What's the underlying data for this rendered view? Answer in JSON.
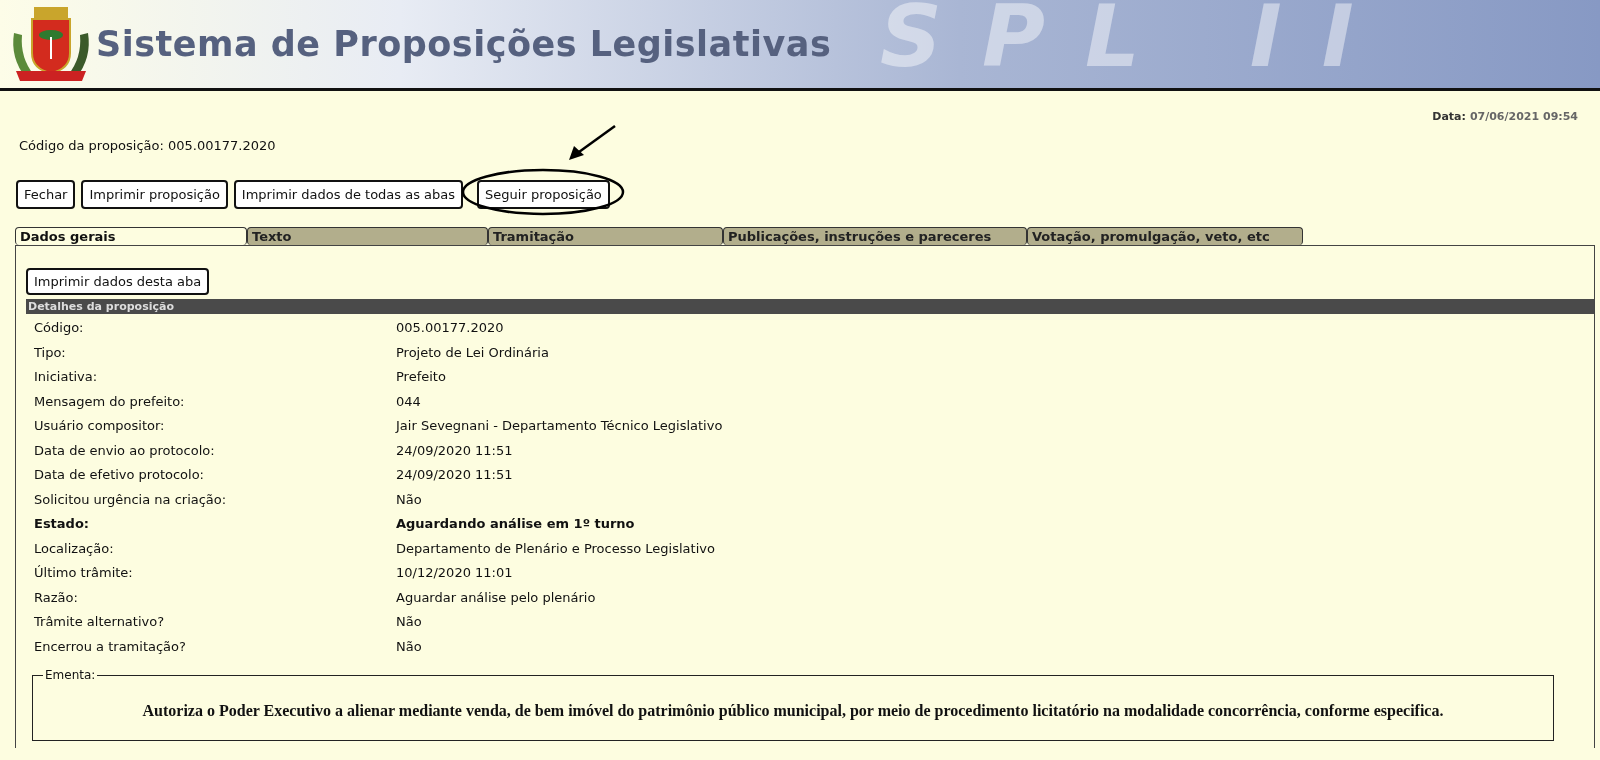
{
  "header": {
    "title": "Sistema de Proposições Legislativas",
    "banner_text": "SPL II"
  },
  "date": {
    "label": "Data:",
    "value": "07/06/2021 09:54"
  },
  "code_line": "Código da proposição: 005.00177.2020",
  "buttons": [
    {
      "label": "Fechar",
      "highlighted": false
    },
    {
      "label": "Imprimir proposição",
      "highlighted": false
    },
    {
      "label": "Imprimir dados de todas as abas",
      "highlighted": false
    },
    {
      "label": "Seguir proposição",
      "highlighted": true
    }
  ],
  "tabs": [
    {
      "label": "Dados gerais",
      "selected": true
    },
    {
      "label": "Texto",
      "selected": false
    },
    {
      "label": "Tramitação",
      "selected": false
    },
    {
      "label": "Publicações, instruções e pareceres",
      "selected": false
    },
    {
      "label": "Votação, promulgação, veto, etc",
      "selected": false
    }
  ],
  "panel": {
    "print_button": "Imprimir dados desta aba",
    "section_title": "Detalhes da proposição",
    "rows": [
      {
        "label": "Código:",
        "value": "005.00177.2020",
        "bold": false
      },
      {
        "label": "Tipo:",
        "value": "Projeto de Lei Ordinária",
        "bold": false
      },
      {
        "label": "Iniciativa:",
        "value": "Prefeito",
        "bold": false
      },
      {
        "label": "Mensagem do prefeito:",
        "value": "044",
        "bold": false
      },
      {
        "label": "Usuário compositor:",
        "value": "Jair Sevegnani - Departamento Técnico Legislativo",
        "bold": false
      },
      {
        "label": "Data de envio ao protocolo:",
        "value": "24/09/2020 11:51",
        "bold": false
      },
      {
        "label": "Data de efetivo protocolo:",
        "value": "24/09/2020 11:51",
        "bold": false
      },
      {
        "label": "Solicitou urgência na criação:",
        "value": "Não",
        "bold": false
      },
      {
        "label": "Estado:",
        "value": "Aguardando análise em 1º turno",
        "bold": true
      },
      {
        "label": "Localização:",
        "value": "Departamento de Plenário e Processo Legislativo",
        "bold": false
      },
      {
        "label": "Último trâmite:",
        "value": "10/12/2020 11:01",
        "bold": false
      },
      {
        "label": "Razão:",
        "value": "Aguardar análise pelo plenário",
        "bold": false
      },
      {
        "label": "Trâmite alternativo?",
        "value": "Não",
        "bold": false
      },
      {
        "label": "Encerrou a tramitação?",
        "value": "Não",
        "bold": false
      }
    ],
    "ementa": {
      "legend": "Ementa:",
      "text": "Autoriza o Poder Executivo a alienar mediante venda, de bem imóvel do patrimônio público municipal, por meio de procedimento licitatório na modalidade concorrência, conforme especifica."
    }
  }
}
